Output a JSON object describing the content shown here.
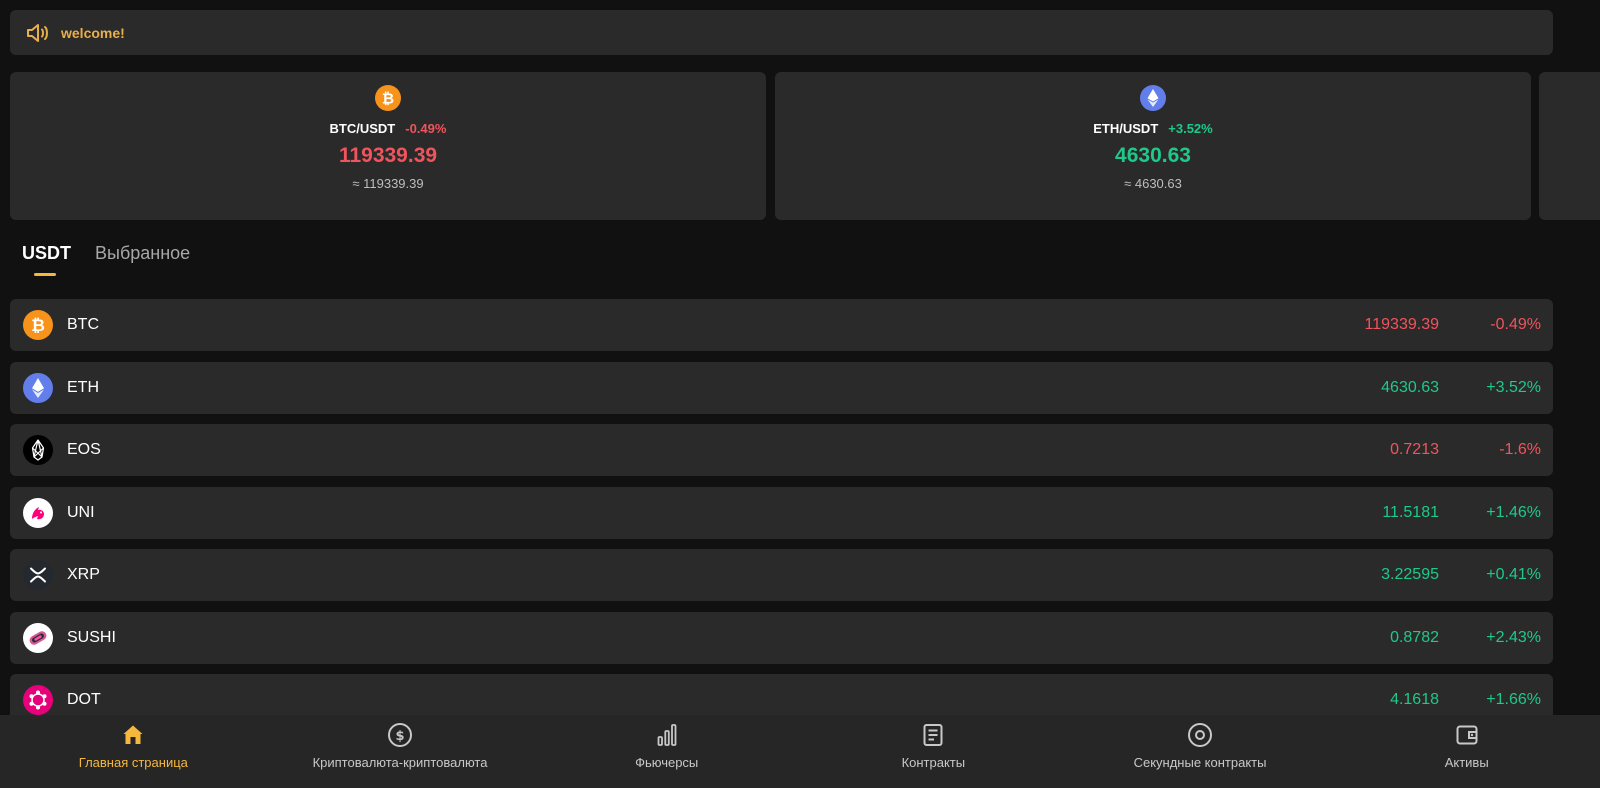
{
  "notice": {
    "text": "welcome!"
  },
  "tickers": [
    {
      "coin_icon": "btc-icon",
      "pair": "BTC/USDT",
      "change": "-0.49%",
      "price": "119339.39",
      "approx": "≈ 119339.39",
      "trend": "down"
    },
    {
      "coin_icon": "eth-icon",
      "pair": "ETH/USDT",
      "change": "+3.52%",
      "price": "4630.63",
      "approx": "≈ 4630.63",
      "trend": "up"
    }
  ],
  "tabs": [
    {
      "label": "USDT",
      "active": true
    },
    {
      "label": "Выбранное",
      "active": false
    }
  ],
  "markets": [
    {
      "symbol": "BTC",
      "icon": "btc-icon",
      "price": "119339.39",
      "change": "-0.49%",
      "trend": "down"
    },
    {
      "symbol": "ETH",
      "icon": "eth-icon",
      "price": "4630.63",
      "change": "+3.52%",
      "trend": "up"
    },
    {
      "symbol": "EOS",
      "icon": "eos-icon",
      "price": "0.7213",
      "change": "-1.6%",
      "trend": "down"
    },
    {
      "symbol": "UNI",
      "icon": "uni-icon",
      "price": "11.5181",
      "change": "+1.46%",
      "trend": "up"
    },
    {
      "symbol": "XRP",
      "icon": "xrp-icon",
      "price": "3.22595",
      "change": "+0.41%",
      "trend": "up"
    },
    {
      "symbol": "SUSHI",
      "icon": "sushi-icon",
      "price": "0.8782",
      "change": "+2.43%",
      "trend": "up"
    },
    {
      "symbol": "DOT",
      "icon": "dot-icon",
      "price": "4.1618",
      "change": "+1.66%",
      "trend": "up"
    }
  ],
  "nav": [
    {
      "label": "Главная страница",
      "icon": "home-icon",
      "active": true
    },
    {
      "label": "Криптовалюта-криптовалюта",
      "icon": "dollar-circle-icon",
      "active": false
    },
    {
      "label": "Фьючерсы",
      "icon": "bar-chart-icon",
      "active": false
    },
    {
      "label": "Контракты",
      "icon": "document-icon",
      "active": false
    },
    {
      "label": "Секундные контракты",
      "icon": "target-icon",
      "active": false
    },
    {
      "label": "Активы",
      "icon": "wallet-icon",
      "active": false
    }
  ],
  "colors": {
    "accent": "#f5b83d",
    "up": "#1ec98a",
    "down": "#f0545c",
    "card": "#2a2a2a",
    "background": "#111111"
  }
}
